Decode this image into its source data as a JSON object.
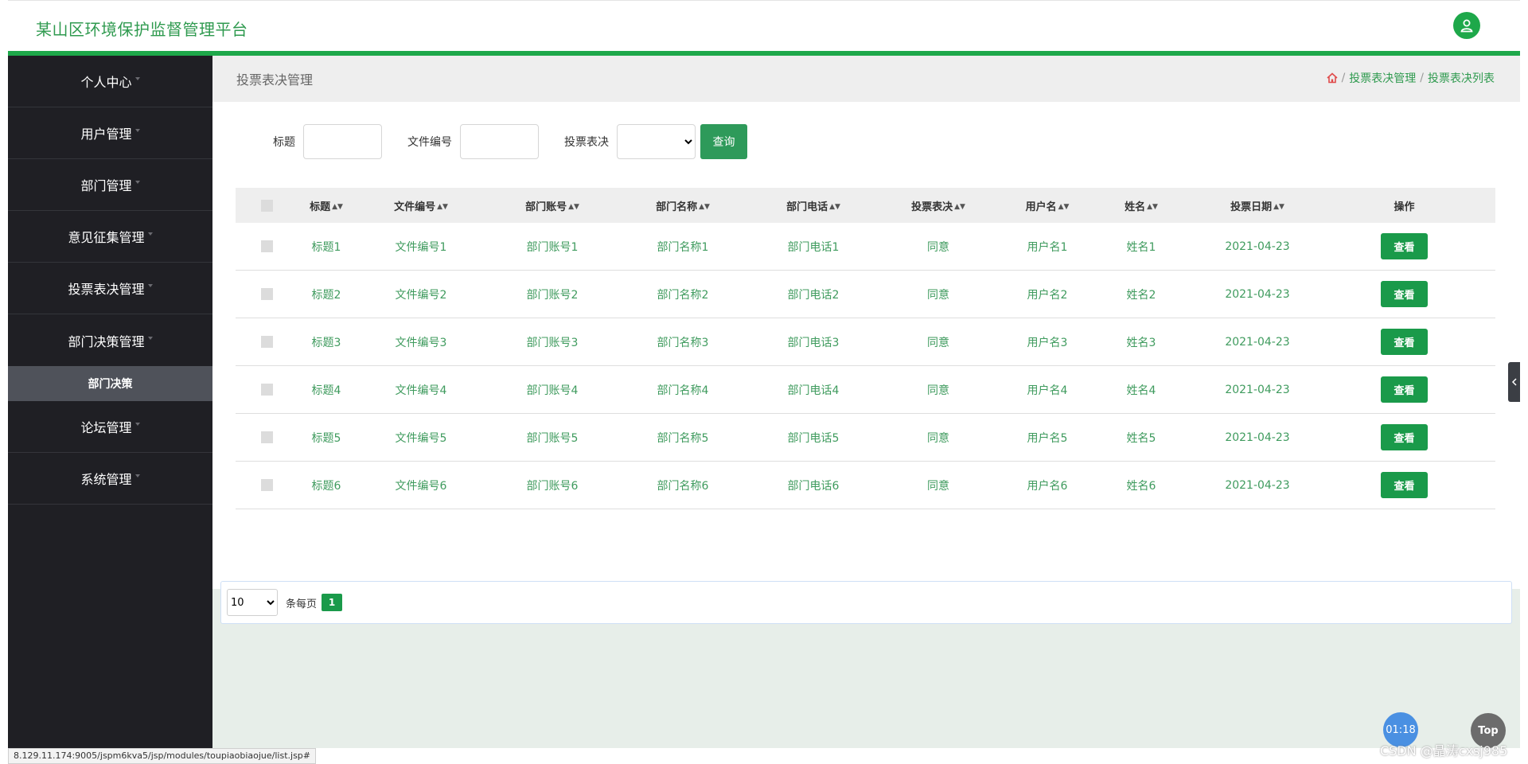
{
  "app": {
    "title": "某山区环境保护监督管理平台"
  },
  "sidebar": {
    "items": [
      {
        "label": "个人中心"
      },
      {
        "label": "用户管理"
      },
      {
        "label": "部门管理"
      },
      {
        "label": "意见征集管理"
      },
      {
        "label": "投票表决管理"
      },
      {
        "label": "部门决策管理"
      },
      {
        "label": "论坛管理"
      },
      {
        "label": "系统管理"
      }
    ],
    "submenu": {
      "label": "部门决策"
    }
  },
  "breadcrumb": {
    "page_title": "投票表决管理",
    "separator": "/",
    "items": [
      "投票表决管理",
      "投票表决列表"
    ]
  },
  "search": {
    "title_label": "标题",
    "file_no_label": "文件编号",
    "vote_label": "投票表决",
    "query_button": "查询"
  },
  "table": {
    "headers": [
      "标题",
      "文件编号",
      "部门账号",
      "部门名称",
      "部门电话",
      "投票表决",
      "用户名",
      "姓名",
      "投票日期",
      "操作"
    ],
    "rows": [
      [
        "标题1",
        "文件编号1",
        "部门账号1",
        "部门名称1",
        "部门电话1",
        "同意",
        "用户名1",
        "姓名1",
        "2021-04-23"
      ],
      [
        "标题2",
        "文件编号2",
        "部门账号2",
        "部门名称2",
        "部门电话2",
        "同意",
        "用户名2",
        "姓名2",
        "2021-04-23"
      ],
      [
        "标题3",
        "文件编号3",
        "部门账号3",
        "部门名称3",
        "部门电话3",
        "同意",
        "用户名3",
        "姓名3",
        "2021-04-23"
      ],
      [
        "标题4",
        "文件编号4",
        "部门账号4",
        "部门名称4",
        "部门电话4",
        "同意",
        "用户名4",
        "姓名4",
        "2021-04-23"
      ],
      [
        "标题5",
        "文件编号5",
        "部门账号5",
        "部门名称5",
        "部门电话5",
        "同意",
        "用户名5",
        "姓名5",
        "2021-04-23"
      ],
      [
        "标题6",
        "文件编号6",
        "部门账号6",
        "部门名称6",
        "部门电话6",
        "同意",
        "用户名6",
        "姓名6",
        "2021-04-23"
      ]
    ],
    "view_button": "查看"
  },
  "pagination": {
    "page_size": "10",
    "per_page_label": "条每页",
    "current_page": "1"
  },
  "status_bar": {
    "url": "8.129.11.174:9005/jspm6kva5/jsp/modules/toupiaobiaojue/list.jsp#"
  },
  "overlay": {
    "timer": "01:18",
    "top_button": "Top",
    "watermark": "CSDN @晶涛cxsj985"
  },
  "icons": {
    "user": "user-icon",
    "home": "home-icon",
    "collapse": "chevron-left-icon",
    "sort": "sort-icon"
  },
  "colors": {
    "accent_green": "#1ea84a",
    "text_green": "#3f9b5e",
    "sidebar_bg": "#1f1f24",
    "submenu_bg": "#4f525a",
    "home_icon": "#e04b4b"
  }
}
